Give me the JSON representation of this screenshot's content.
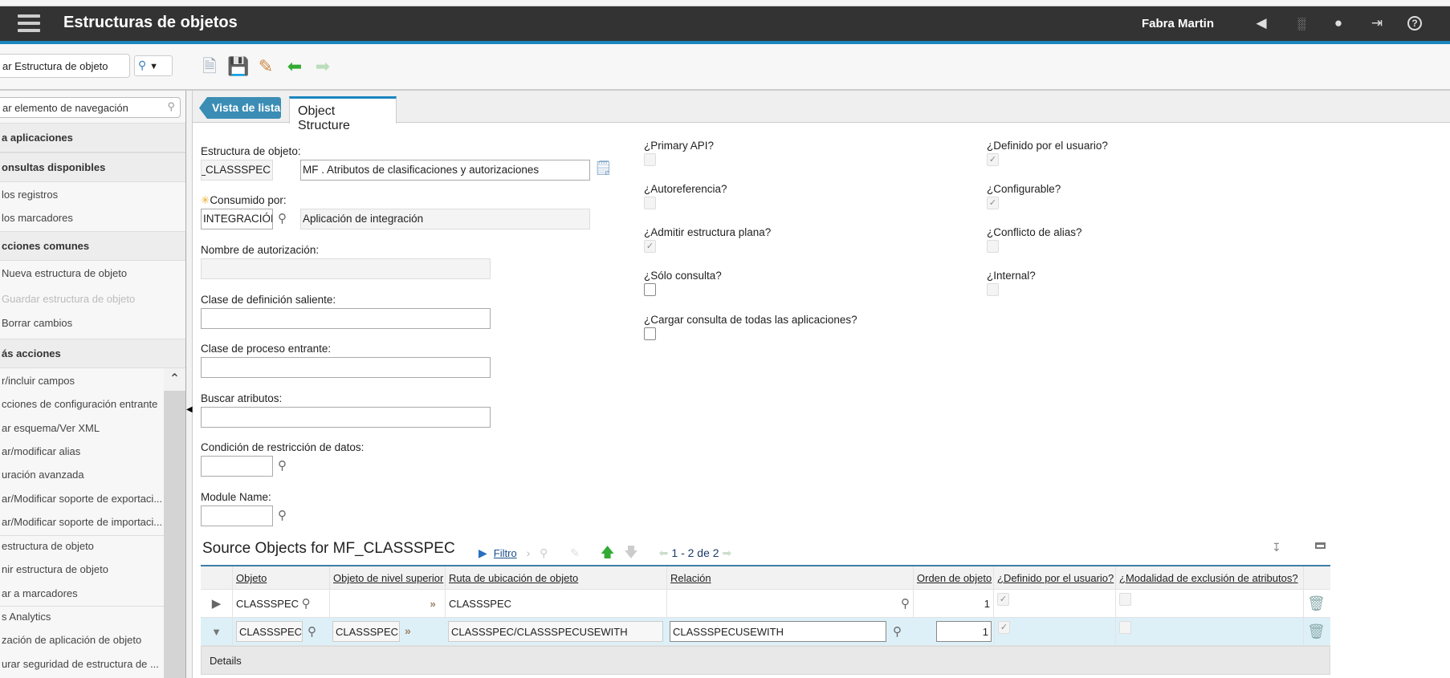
{
  "header": {
    "title": "Estructuras de objetos",
    "user": "Fabra Martin",
    "icons": [
      "megaphone-icon",
      "reports-icon",
      "profile-icon",
      "signout-icon",
      "help-icon"
    ]
  },
  "toolbar": {
    "app_search_value": "ar Estructura de objeto",
    "search_menu_icon": "search-icon",
    "icons": [
      "new-record-icon",
      "save-icon",
      "clear-changes-icon",
      "previous-icon",
      "next-icon"
    ]
  },
  "sidebar": {
    "search_placeholder": "ar elemento de navegación",
    "sections": [
      {
        "title": "a aplicaciones",
        "items": []
      },
      {
        "title": "onsultas disponibles",
        "items": [
          "los registros",
          "los marcadores"
        ]
      },
      {
        "title": "cciones comunes",
        "items": [
          "Nueva estructura de objeto",
          "Guardar estructura de objeto",
          "Borrar cambios"
        ]
      },
      {
        "title": "ás acciones",
        "items": [
          "r/incluir campos",
          "cciones de configuración entrante",
          "ar esquema/Ver XML",
          "ar/modificar alias",
          "uración avanzada",
          "ar/Modificar soporte de exportaci...",
          "ar/Modificar soporte de importaci...",
          "estructura de objeto",
          "nir estructura de objeto",
          "ar a marcadores",
          "s Analytics",
          "zación de aplicación de objeto",
          "urar seguridad de estructura de ..."
        ]
      }
    ]
  },
  "tabs": {
    "list": "Vista de lista",
    "active": "Object Structure"
  },
  "form": {
    "estructura_label": "Estructura de objeto:",
    "estructura_value": "F_CLASSSPEC",
    "descripcion_value": "MF . Atributos de clasificaciones y autorizaciones",
    "consumido_label": "Consumido por:",
    "consumido_value": "INTEGRACIÓN",
    "consumido_desc": "Aplicación de integración",
    "autorizacion_label": "Nombre de autorización:",
    "autorizacion_value": "",
    "saliente_label": "Clase de definición saliente:",
    "saliente_value": "",
    "entrante_label": "Clase de proceso entrante:",
    "entrante_value": "",
    "buscar_label": "Buscar atributos:",
    "buscar_value": "",
    "condicion_label": "Condición de restricción de datos:",
    "condicion_value": "",
    "module_label": "Module Name:",
    "module_value": "",
    "checks_left": [
      {
        "label": "¿Primary API?",
        "checked": false,
        "editable": false
      },
      {
        "label": "¿Autoreferencia?",
        "checked": false,
        "editable": false
      },
      {
        "label": "¿Admitir estructura plana?",
        "checked": true,
        "editable": false
      },
      {
        "label": "¿Sólo consulta?",
        "checked": false,
        "editable": true
      },
      {
        "label": "¿Cargar consulta de todas las aplicaciones?",
        "checked": false,
        "editable": true
      }
    ],
    "checks_right": [
      {
        "label": "¿Definido por el usuario?",
        "checked": true,
        "editable": false
      },
      {
        "label": "¿Configurable?",
        "checked": true,
        "editable": false
      },
      {
        "label": "¿Conflicto de alias?",
        "checked": false,
        "editable": false
      },
      {
        "label": "¿Internal?",
        "checked": false,
        "editable": false
      }
    ]
  },
  "table": {
    "title": "Source Objects for MF_CLASSSPEC",
    "filter": "Filtro",
    "pagination": "1 - 2 de 2",
    "columns": [
      "Objeto",
      "Objeto de nivel superior",
      "Ruta de ubicación de objeto",
      "Relación",
      "Orden de objeto",
      "¿Definido por el usuario?",
      "¿Modalidad de exclusión de atributos?"
    ],
    "rows": [
      {
        "objeto": "CLASSSPEC",
        "superior": "",
        "ruta": "CLASSSPEC",
        "relacion": "",
        "orden": "1",
        "definido": true,
        "exclusion": false
      },
      {
        "objeto": "CLASSSPEC",
        "superior": "CLASSSPEC",
        "ruta": "CLASSSPEC/CLASSSPECUSEWITH",
        "relacion": "CLASSSPECUSEWITH",
        "orden": "1",
        "definido": true,
        "exclusion": false
      }
    ],
    "details": "Details"
  },
  "colors": {
    "header": "#333333",
    "accent": "#1a86c0",
    "list_tab": "#3b8db5",
    "selected_row": "#ddf0f8"
  }
}
